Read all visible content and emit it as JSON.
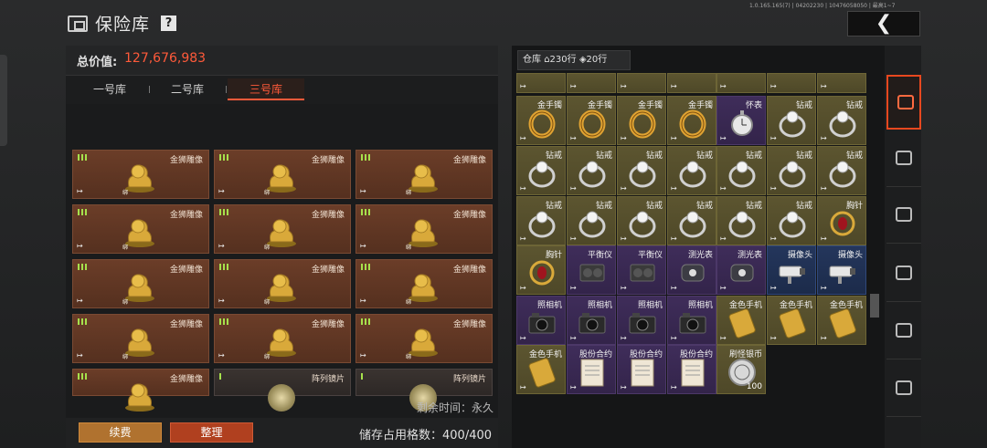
{
  "header": {
    "title": "保险库",
    "help": "?",
    "build_info": "1.0.165.165(7) | 04202230 | 10476058050 | 最高1~7",
    "back": "❮"
  },
  "vault": {
    "total_label": "总价值:",
    "total_value": "127,676,983",
    "tabs": [
      "一号库",
      "二号库",
      "三号库"
    ],
    "active_tab": 2,
    "slot_names": {
      "lion": "金狮雕像",
      "lens": "阵列镜片"
    },
    "bind_mark": "绑",
    "remain": "剩余时间：永久",
    "renew": "续费",
    "sort": "整理",
    "storage": "储存占用格数：400/400"
  },
  "warehouse": {
    "label": "仓库",
    "rows_a": "230行",
    "rows_b": "20行",
    "items": [
      [
        "金手镯",
        "金手镯",
        "金手镯",
        "金手镯",
        "怀表",
        "钻戒",
        "钻戒"
      ],
      [
        "钻戒",
        "钻戒",
        "钻戒",
        "钻戒",
        "钻戒",
        "钻戒",
        "钻戒"
      ],
      [
        "钻戒",
        "钻戒",
        "钻戒",
        "钻戒",
        "钻戒",
        "钻戒",
        "胸针"
      ],
      [
        "胸针",
        "平衡仪",
        "平衡仪",
        "测光表",
        "测光表",
        "摄像头",
        "摄像头"
      ],
      [
        "照相机",
        "照相机",
        "照相机",
        "照相机",
        "金色手机",
        "金色手机",
        "金色手机"
      ],
      [
        "金色手机",
        "股份合约",
        "股份合约",
        "股份合约",
        "刷怪银币"
      ]
    ],
    "coin_count": "100"
  },
  "colors": {
    "accent": "#ff5a3a",
    "gold_cell": "#5c5530",
    "purple_cell": "#3f2d5a",
    "blue_cell": "#24365c",
    "vault_slot": "#6b3d28"
  }
}
